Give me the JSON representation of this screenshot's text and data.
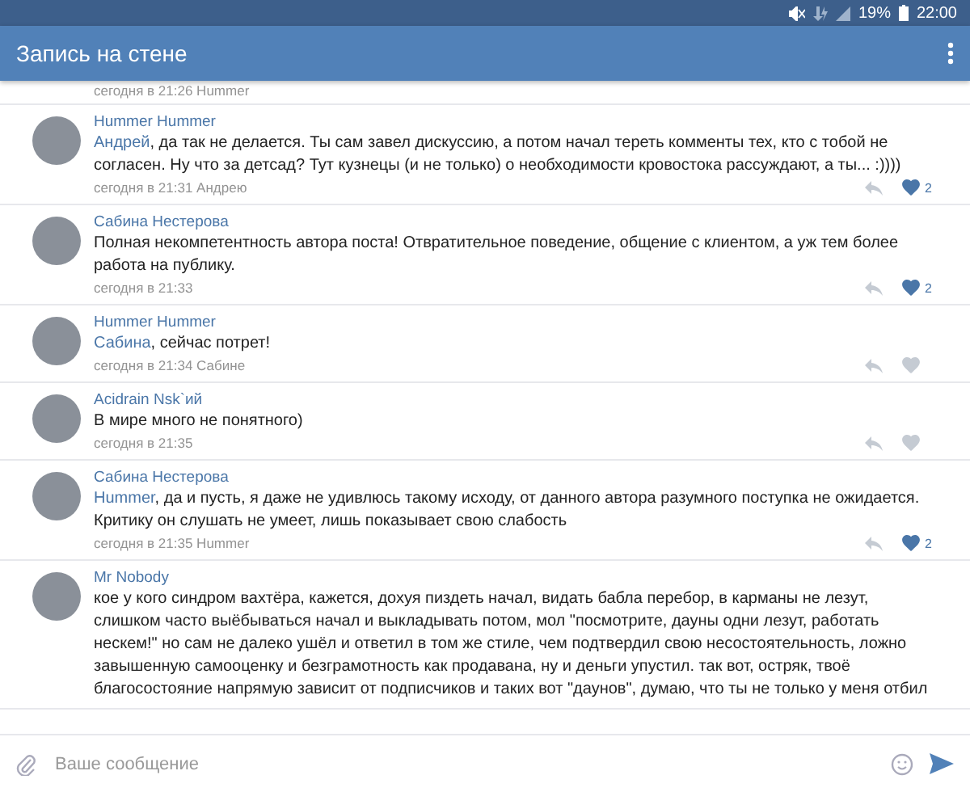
{
  "status_bar": {
    "battery": "19%",
    "time": "22:00"
  },
  "app_bar": {
    "title": "Запись на стене"
  },
  "partial_comment": {
    "time": "сегодня в 21:26 Hummer"
  },
  "comments": [
    {
      "author": "Hummer Hummer",
      "mention": "Андрей",
      "text": ", да так не делается. Ты сам завел дискуссию, а потом начал тереть комменты тех, кто с тобой не согласен. Ну что за детсад? Тут кузнецы (и не только) о необходимости кровостока рассуждают, а ты... :))))",
      "time": "сегодня в 21:31 Андрею",
      "liked": true,
      "likes": "2"
    },
    {
      "author": "Сабина Нестерова",
      "text": "Полная некомпетентность автора поста! Отвратительное поведение, общение с клиентом, а уж тем более работа на публику.",
      "time": "сегодня в 21:33",
      "liked": true,
      "likes": "2"
    },
    {
      "author": "Hummer Hummer",
      "mention": "Сабина",
      "text": ", сейчас потрет!",
      "time": "сегодня в 21:34 Сабине",
      "liked": false
    },
    {
      "author": "Acidrain Nsk`ий",
      "text": "В мире много не понятного)",
      "time": "сегодня в 21:35",
      "liked": false
    },
    {
      "author": "Сабина Нестерова",
      "mention": "Hummer",
      "text": ", да и пусть, я даже не удивлюсь такому исходу, от данного автора разумного поступка не ожидается. Критику он слушать не умеет, лишь показывает свою слабость",
      "time": "сегодня в 21:35 Hummer",
      "liked": true,
      "likes": "2"
    },
    {
      "author": "Mr Nobody",
      "text": "кое у кого синдром вахтёра, кажется, дохуя пиздеть начал, видать бабла перебор, в карманы не лезут, слишком часто выёбываться начал и выкладывать потом, мол \"посмотрите, дауны одни лезут, работать нескем!\" но сам не далеко ушёл и ответил в том же стиле, чем подтвердил свою несостоятельность, ложно завышенную самооценку и безграмотность как продавана, ну и деньги упустил. так вот, остряк, твоё благосостояние напрямую зависит от подписчиков и таких вот \"даунов\", думаю, что ты не только у меня отбил"
    }
  ],
  "composer": {
    "placeholder": "Ваше сообщение"
  }
}
